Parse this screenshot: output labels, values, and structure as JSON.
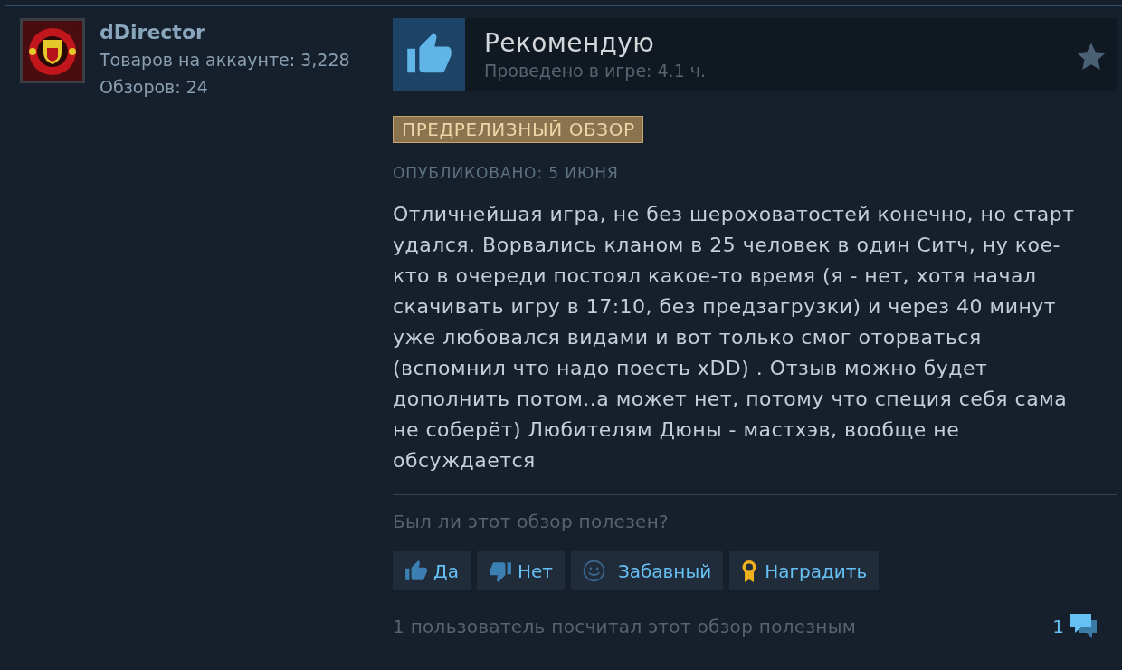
{
  "reviewer": {
    "name": "dDirector",
    "stats": [
      "Товаров на аккаунте: 3,228",
      "Обзоров: 24"
    ]
  },
  "review": {
    "recommended": true,
    "verdict": "Рекомендую",
    "playtime": "Проведено в игре: 4.1 ч.",
    "badge": "ПРЕДРЕЛИЗНЫЙ ОБЗОР",
    "posted": "ОПУБЛИКОВАНО: 5 ИЮНЯ",
    "text": "Отличнейшая игра, не без шероховатостей конечно, но старт удался. Ворвались кланом в 25 человек в один Ситч, ну кое-кто в очереди постоял какое-то время (я - нет, хотя начал скачивать игру в 17:10, без предзагрузки) и через 40 минут уже любовался видами и вот только смог оторваться (вспомнил что надо поесть xDD) . Отзыв можно будет дополнить потом..а может нет, потому что специя себя сама не соберёт) Любителям Дюны - мастхэв, вообще не обсуждается"
  },
  "feedback": {
    "question": "Был ли этот обзор полезен?",
    "buttons": [
      {
        "kind": "yes",
        "label": "Да"
      },
      {
        "kind": "no",
        "label": "Нет"
      },
      {
        "kind": "funny",
        "label": "Забавный"
      },
      {
        "kind": "award",
        "label": "Наградить"
      }
    ],
    "summary": "1 пользователь посчитал этот обзор полезным",
    "comment_count": "1"
  }
}
